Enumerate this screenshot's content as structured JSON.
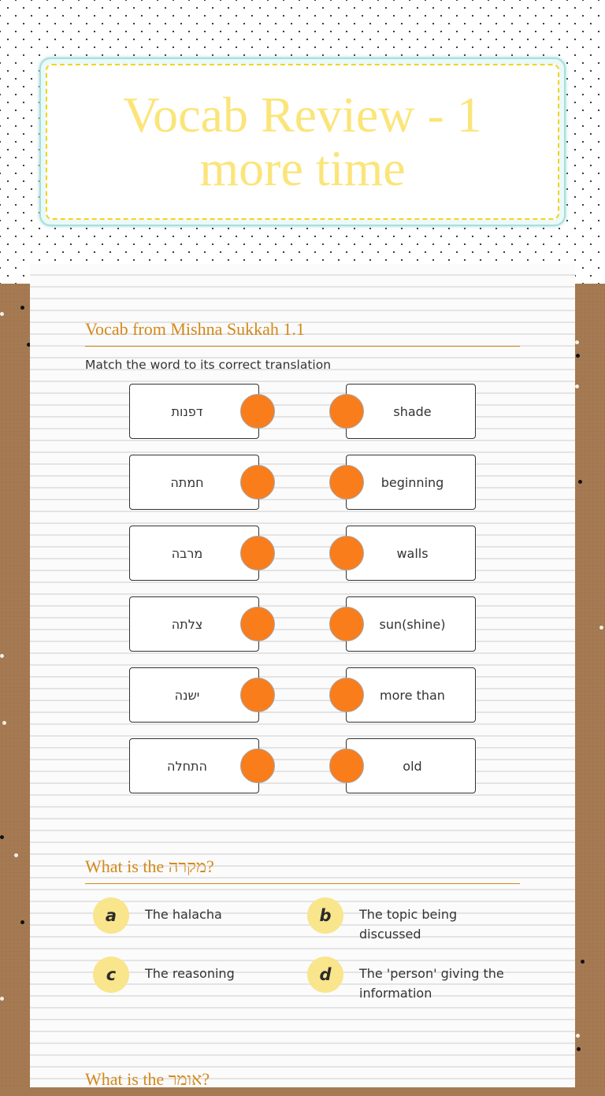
{
  "header": {
    "title": "Vocab Review - 1 more time"
  },
  "colors": {
    "accent_orange": "#d4891a",
    "match_dot": "#fa7d1c",
    "title_yellow": "#fbe57a",
    "choice_yellow": "#f9e58b",
    "card_border": "#a9dedd",
    "cork": "#a57a52"
  },
  "match_section": {
    "title": "Vocab from Mishna Sukkah 1.1",
    "instruction": "Match the word to its correct translation",
    "left_items": [
      {
        "label": "דפנות"
      },
      {
        "label": "חמתה"
      },
      {
        "label": "מרבה"
      },
      {
        "label": "צלתה"
      },
      {
        "label": "ישנה"
      },
      {
        "label": "התחלה"
      }
    ],
    "right_items": [
      {
        "label": "shade"
      },
      {
        "label": "beginning"
      },
      {
        "label": "walls"
      },
      {
        "label": "sun(shine)"
      },
      {
        "label": "more than"
      },
      {
        "label": "old"
      }
    ]
  },
  "question_1": {
    "title": "What is the מקרה?",
    "choices": [
      {
        "letter": "a",
        "text": "The halacha"
      },
      {
        "letter": "b",
        "text": "The topic being discussed"
      },
      {
        "letter": "c",
        "text": "The reasoning"
      },
      {
        "letter": "d",
        "text": "The 'person' giving the information"
      }
    ]
  },
  "question_2": {
    "title": "What is the אומר?"
  }
}
